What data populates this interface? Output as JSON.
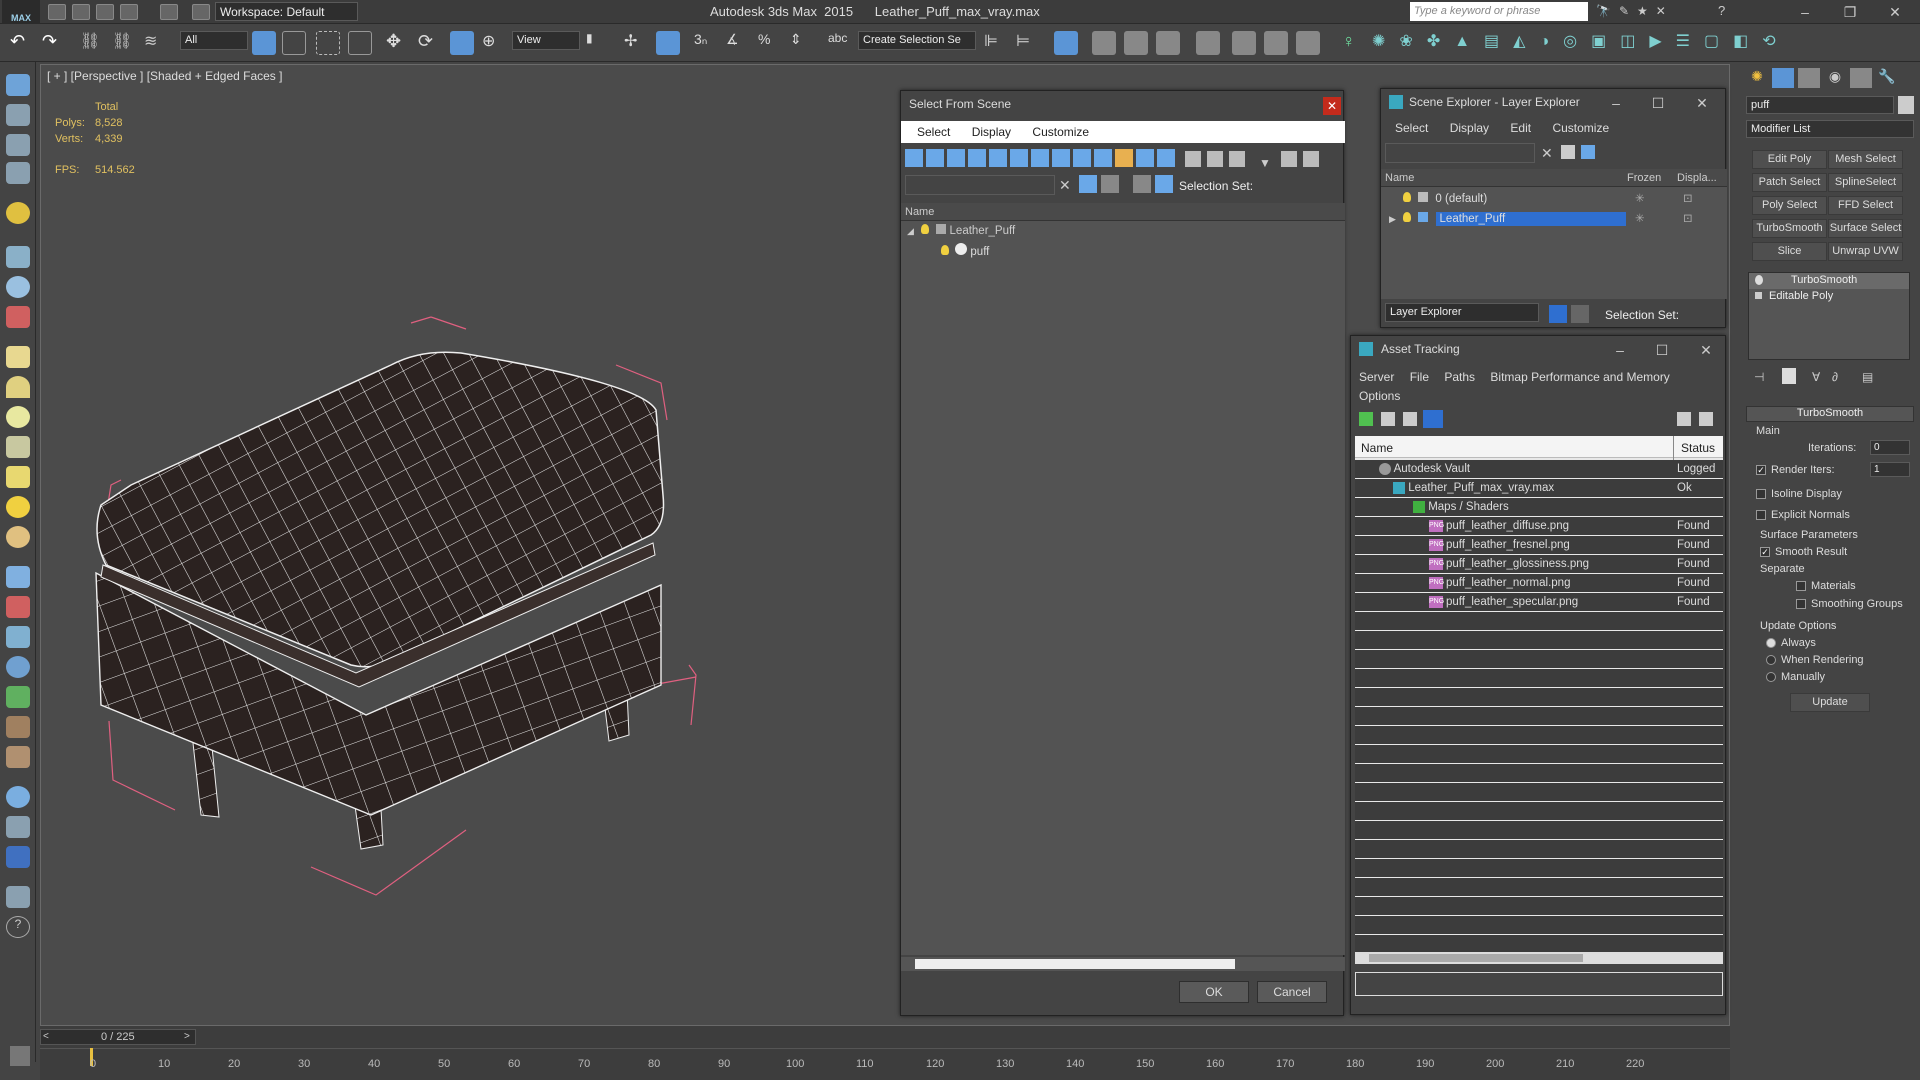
{
  "app": {
    "title": "Autodesk 3ds Max  2015      Leather_Puff_max_vray.max",
    "workspace": "Workspace: Default",
    "search_placeholder": "Type a keyword or phrase",
    "logo": "MAX"
  },
  "toolbar": {
    "filter": "All",
    "ref_coord": "View",
    "selection_set": "Create Selection Se"
  },
  "viewport": {
    "label": "[ + ] [Perspective ] [Shaded + Edged Faces ]",
    "stats": {
      "total_label": "Total",
      "polys_label": "Polys:",
      "polys": "8,528",
      "verts_label": "Verts:",
      "verts": "4,339",
      "fps_label": "FPS:",
      "fps": "514.562"
    }
  },
  "select_from_scene": {
    "title": "Select From Scene",
    "menu": [
      "Select",
      "Display",
      "Customize"
    ],
    "selection_set_label": "Selection Set:",
    "column_name": "Name",
    "tree": [
      {
        "name": "Leather_Puff",
        "level": 0
      },
      {
        "name": "puff",
        "level": 1
      }
    ],
    "ok": "OK",
    "cancel": "Cancel"
  },
  "scene_explorer": {
    "title": "Scene Explorer - Layer Explorer",
    "menu": [
      "Select",
      "Display",
      "Edit",
      "Customize"
    ],
    "columns": [
      "Name",
      "Frozen",
      "Displa..."
    ],
    "rows": [
      {
        "name": "0 (default)",
        "selected": false
      },
      {
        "name": "Leather_Puff",
        "selected": true
      }
    ],
    "footer_dropdown": "Layer Explorer",
    "selection_set_label": "Selection Set:"
  },
  "asset_tracking": {
    "title": "Asset Tracking",
    "menu": [
      "Server",
      "File",
      "Paths",
      "Bitmap Performance and Memory",
      "Options"
    ],
    "columns": [
      "Name",
      "Status"
    ],
    "rows": [
      {
        "name": "Autodesk Vault",
        "status": "Logged",
        "indent": 0,
        "icon": "vault"
      },
      {
        "name": "Leather_Puff_max_vray.max",
        "status": "Ok",
        "indent": 1,
        "icon": "max"
      },
      {
        "name": "Maps / Shaders",
        "status": "",
        "indent": 2,
        "icon": "folder"
      },
      {
        "name": "puff_leather_diffuse.png",
        "status": "Found",
        "indent": 3,
        "icon": "png"
      },
      {
        "name": "puff_leather_fresnel.png",
        "status": "Found",
        "indent": 3,
        "icon": "png"
      },
      {
        "name": "puff_leather_glossiness.png",
        "status": "Found",
        "indent": 3,
        "icon": "png"
      },
      {
        "name": "puff_leather_normal.png",
        "status": "Found",
        "indent": 3,
        "icon": "png"
      },
      {
        "name": "puff_leather_specular.png",
        "status": "Found",
        "indent": 3,
        "icon": "png"
      }
    ]
  },
  "command_panel": {
    "object_name": "puff",
    "modifier_list": "Modifier List",
    "modifier_buttons": [
      "Edit Poly",
      "Mesh Select",
      "Patch Select",
      "SplineSelect",
      "Poly Select",
      "FFD Select",
      "TurboSmooth",
      "Surface Select",
      "Slice",
      "Unwrap UVW"
    ],
    "stack": [
      "TurboSmooth",
      "Editable Poly"
    ],
    "rollout_title": "TurboSmooth",
    "main_label": "Main",
    "iterations_label": "Iterations:",
    "iterations": "0",
    "render_iters_label": "Render Iters:",
    "render_iters": "1",
    "isoline_display": "Isoline Display",
    "explicit_normals": "Explicit Normals",
    "surface_params": "Surface Parameters",
    "smooth_result": "Smooth Result",
    "separate": "Separate",
    "materials": "Materials",
    "smoothing_groups": "Smoothing Groups",
    "update_options": "Update Options",
    "always": "Always",
    "when_rendering": "When Rendering",
    "manually": "Manually",
    "update_button": "Update"
  },
  "timeline": {
    "frame_counter": "0 / 225",
    "ticks": [
      "0",
      "10",
      "20",
      "30",
      "40",
      "50",
      "60",
      "70",
      "80",
      "90",
      "100",
      "110",
      "120",
      "130",
      "140",
      "150",
      "160",
      "170",
      "180",
      "190",
      "200",
      "210",
      "220"
    ]
  },
  "colors": {
    "selected_row": "#2f6fd0",
    "status_text": "#e0c060",
    "bbox": "#e06080"
  }
}
